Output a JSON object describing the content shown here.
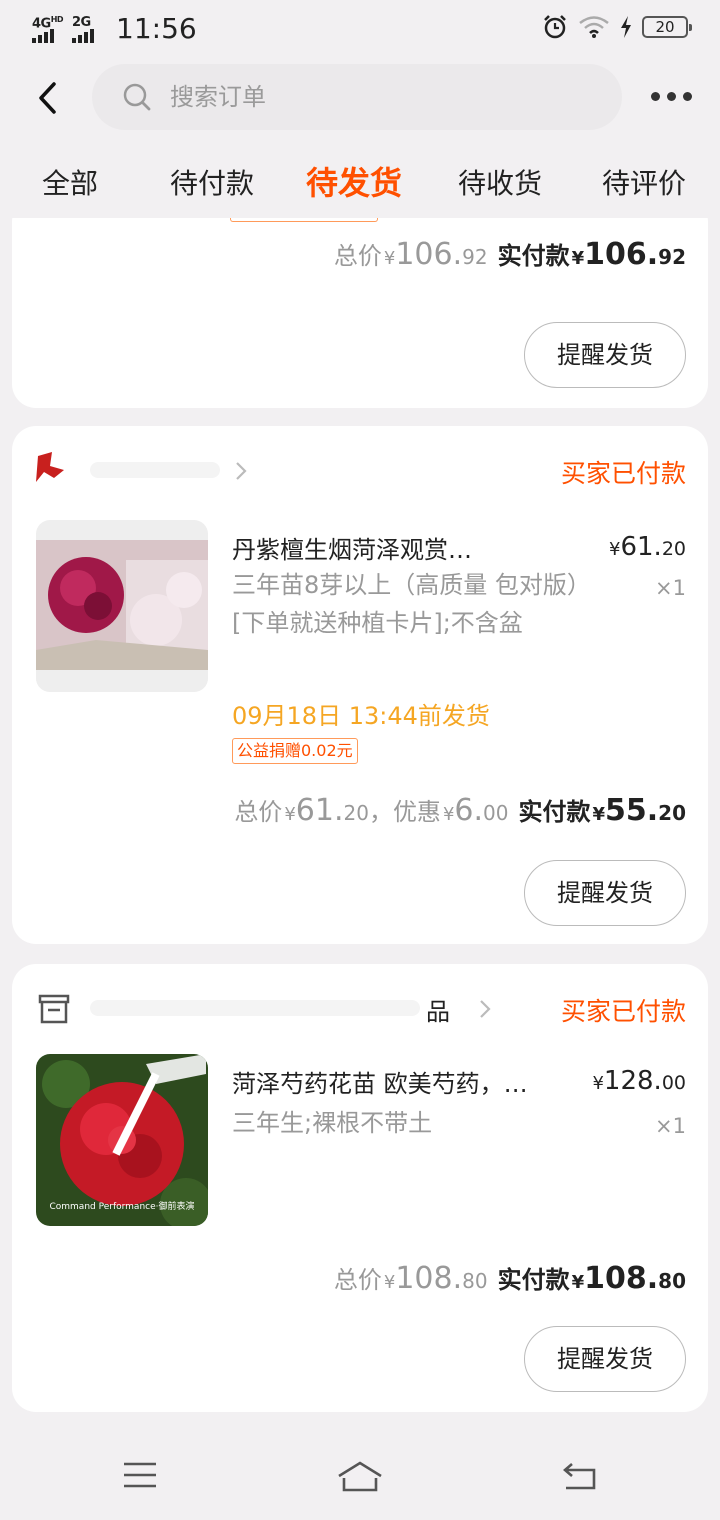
{
  "status_bar": {
    "time": "11:56",
    "network_1": "4G",
    "network_1_sup": "HD",
    "network_2": "2G",
    "battery_level": "20",
    "icons": [
      "alarm-icon",
      "wifi-icon",
      "charging-icon",
      "battery-icon"
    ]
  },
  "header": {
    "search_placeholder": "搜索订单",
    "icons": [
      "back-icon",
      "search-icon",
      "more-icon"
    ]
  },
  "tabs": [
    {
      "label": "全部",
      "active": false
    },
    {
      "label": "待付款",
      "active": false
    },
    {
      "label": "待发货",
      "active": true
    },
    {
      "label": "待收货",
      "active": false
    },
    {
      "label": "待评价",
      "active": false
    }
  ],
  "colors": {
    "accent": "#ff5000",
    "deadline": "#f5a623",
    "background": "#f2f0f2",
    "card": "#ffffff"
  },
  "orders": [
    {
      "total_label": "总价",
      "currency": "¥",
      "total_int": "106.",
      "total_dec": "92",
      "paid_label": "实付款",
      "paid_int": "106.",
      "paid_dec": "92",
      "button": "提醒发货"
    },
    {
      "status": "买家已付款",
      "item_title": "丹紫檀生烟菏泽观赏…",
      "item_spec": "三年苗8芽以上（高质量 包对版）[下单就送种植卡片];不含盆",
      "currency": "¥",
      "item_price_int": "61.",
      "item_price_dec": "20",
      "qty": "×1",
      "ship_deadline": "09月18日 13:44前发货",
      "charity_tag": "公益捐赠0.02元",
      "total_label": "总价",
      "total_int": "61.",
      "total_dec": "20",
      "discount_label": "优惠",
      "discount_int": "6.",
      "discount_dec": "00",
      "paid_label": "实付款",
      "paid_int": "55.",
      "paid_dec": "20",
      "button": "提醒发货"
    },
    {
      "status": "买家已付款",
      "shop_name_suffix": "品",
      "item_title": "菏泽芍药花苗 欧美芍药，…",
      "item_spec": "三年生;裸根不带土",
      "currency": "¥",
      "item_price_int": "128.",
      "item_price_dec": "00",
      "qty": "×1",
      "image_caption": "Command Performance·御前表演",
      "total_label": "总价",
      "total_int": "108.",
      "total_dec": "80",
      "paid_label": "实付款",
      "paid_int": "108.",
      "paid_dec": "80",
      "button": "提醒发货"
    }
  ],
  "bottom_nav": {
    "icons": [
      "menu-icon",
      "home-icon",
      "back-nav-icon"
    ]
  }
}
